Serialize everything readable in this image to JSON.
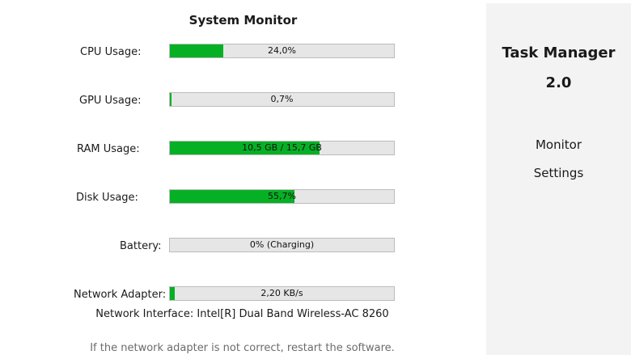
{
  "monitor": {
    "title": "System Monitor",
    "metrics": [
      {
        "label": "CPU Usage:",
        "text": "24,0%",
        "fill_percent": 24.0
      },
      {
        "label": "GPU Usage:",
        "text": "0,7%",
        "fill_percent": 0.7
      },
      {
        "label": "RAM Usage:",
        "text": "10,5 GB / 15,7 GB",
        "fill_percent": 66.9
      },
      {
        "label": "Disk Usage:",
        "text": "55,7%",
        "fill_percent": 55.7
      },
      {
        "label": "Battery:",
        "text": "0% (Charging)",
        "fill_percent": 0
      },
      {
        "label": "Network Adapter:",
        "text": "2,20 KB/s",
        "fill_percent": 2
      }
    ],
    "network_interface": "Network Interface: Intel[R] Dual Band Wireless-AC 8260",
    "note": "If the network adapter is not correct, restart the software."
  },
  "sidebar": {
    "title_line1": "Task Manager",
    "title_line2": "2.0",
    "nav": [
      {
        "label": "Monitor"
      },
      {
        "label": "Settings"
      }
    ]
  },
  "colors": {
    "bar_fill": "#06b025",
    "bar_track": "#e6e6e6",
    "sidebar_bg": "#f3f3f3"
  }
}
